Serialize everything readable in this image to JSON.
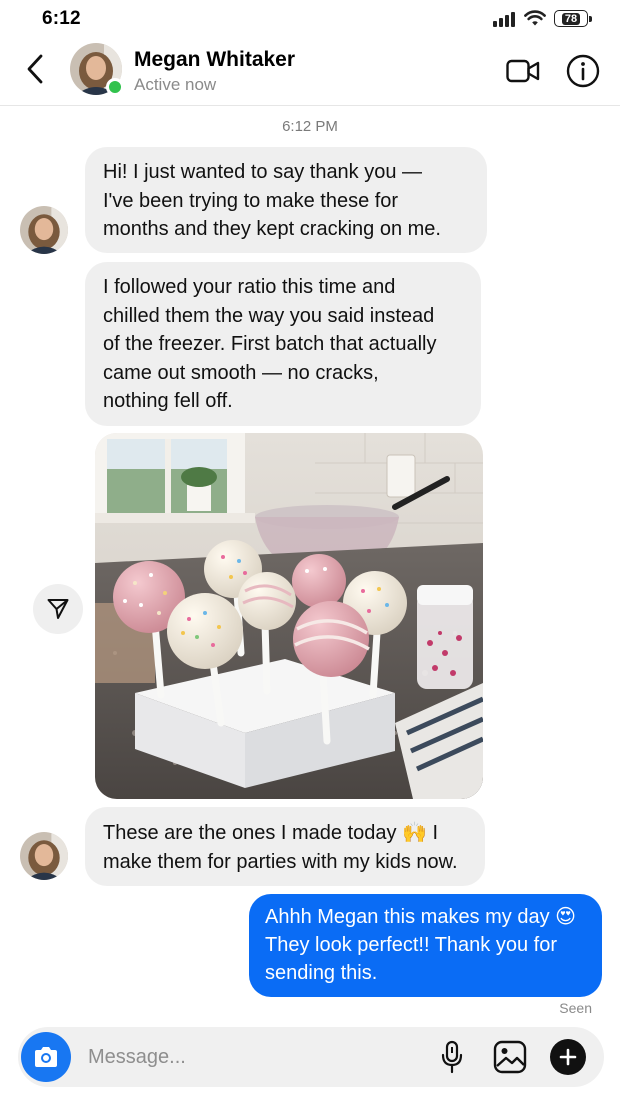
{
  "status_bar": {
    "time": "6:12",
    "battery": "78"
  },
  "header": {
    "back_icon": "chevron-left-icon",
    "contact_name": "Megan Whitaker",
    "contact_status": "Active now",
    "video_icon": "video-camera-icon",
    "info_icon": "info-icon",
    "online_color": "#31c24d"
  },
  "conversation": {
    "timestamp": "6:12 PM",
    "messages": [
      {
        "sender": "Megan Whitaker",
        "direction": "incoming",
        "lines": [
          "Hi! I just wanted to say thank you —",
          "I've been trying to make these for",
          "months and they kept cracking on me."
        ]
      },
      {
        "sender": "Megan Whitaker",
        "direction": "incoming",
        "lines": [
          "I followed your ratio this time and",
          "chilled them the way you said instead",
          "of the freezer. First batch that actually",
          "came out smooth — no cracks,",
          "nothing fell off."
        ]
      },
      {
        "sender": "Megan Whitaker",
        "direction": "incoming",
        "type": "photo",
        "photo_subject": "cake pops in a foam block"
      },
      {
        "sender": "Megan Whitaker",
        "direction": "incoming",
        "lines": [
          "These are the ones I made today 🙌 I",
          "make them for parties with my kids now."
        ]
      },
      {
        "sender": "me",
        "direction": "outgoing",
        "lines": [
          "Ahhh Megan this makes my day 😍",
          "They look perfect!! Thank you for",
          "sending this."
        ]
      }
    ],
    "receipt": "Seen"
  },
  "composer": {
    "placeholder": "Message...",
    "camera_icon": "camera-icon",
    "mic_icon": "microphone-icon",
    "gallery_icon": "image-gallery-icon",
    "plus_icon": "plus-icon"
  },
  "colors": {
    "incoming_bubble": "#efefef",
    "outgoing_bubble": "#0a6cf5",
    "accent": "#1877f2"
  }
}
